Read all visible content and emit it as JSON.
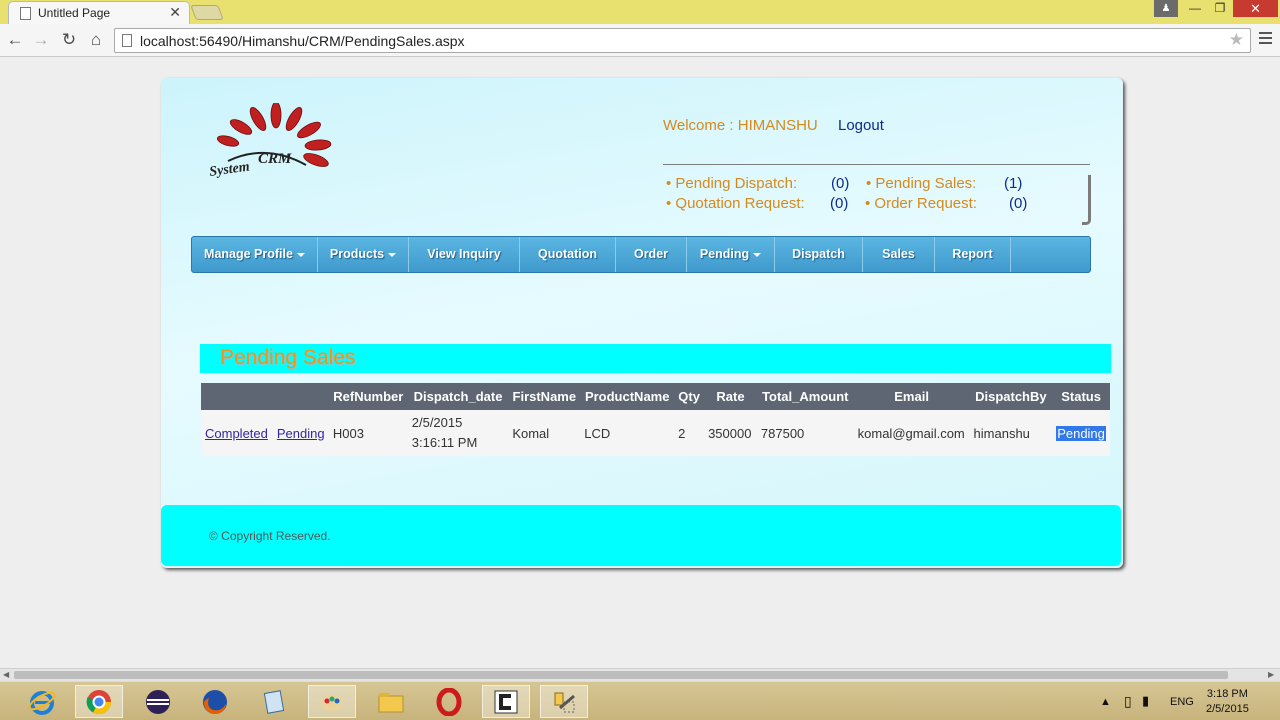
{
  "browser": {
    "tab_title": "Untitled Page",
    "tab_close": "✕",
    "url": "localhost:56490/Himanshu/CRM/PendingSales.aspx",
    "win_user": "♟",
    "win_minimize": "—",
    "win_restore": "❐",
    "win_close": "✕"
  },
  "header": {
    "logo_text_1": "CRM",
    "logo_text_2": "System",
    "welcome": "Welcome : HIMANSHU",
    "logout": "Logout"
  },
  "counts": {
    "pending_dispatch_label": "• Pending Dispatch:",
    "pending_dispatch_value": "(0)",
    "pending_sales_label": "• Pending Sales:",
    "pending_sales_value": "(1)",
    "quotation_request_label": "• Quotation Request:",
    "quotation_request_value": "(0)",
    "order_request_label": "• Order Request:",
    "order_request_value": "(0)"
  },
  "menu": [
    {
      "label": "Manage Profile"
    },
    {
      "label": "Products"
    },
    {
      "label": "View Inquiry"
    },
    {
      "label": "Quotation"
    },
    {
      "label": "Order"
    },
    {
      "label": "Pending"
    },
    {
      "label": "Dispatch"
    },
    {
      "label": "Sales"
    },
    {
      "label": "Report"
    }
  ],
  "section_title": "Pending Sales",
  "grid": {
    "headers": [
      "",
      "",
      "RefNumber",
      "Dispatch_date",
      "FirstName",
      "ProductName",
      "Qty",
      "Rate",
      "Total_Amount",
      "Email",
      "DispatchBy",
      "Status"
    ],
    "rows": [
      {
        "completed_link": "Completed",
        "pending_link": "Pending",
        "ref": "H003",
        "date_line1": "2/5/2015",
        "date_line2": "3:16:11 PM",
        "first_name": "Komal",
        "product": "LCD",
        "qty": "2",
        "rate": "350000",
        "total": "787500",
        "email": "komal@gmail.com",
        "dispatch_by": "himanshu",
        "status": "Pending"
      }
    ]
  },
  "footer": "© Copyright Reserved.",
  "taskbar": {
    "lang": "ENG",
    "time": "3:18 PM",
    "date": "2/5/2015"
  },
  "colors": {
    "accent_orange": "#d48a1e",
    "menu_blue": "#4aa6d8",
    "cyan": "#00ffff"
  }
}
